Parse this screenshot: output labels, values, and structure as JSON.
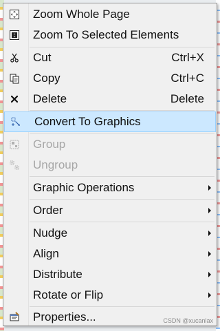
{
  "context_menu": {
    "items": [
      {
        "label": "Zoom Whole Page",
        "icon": "zoom-whole-page-icon"
      },
      {
        "label": "Zoom To Selected Elements",
        "icon": "zoom-selected-icon"
      },
      {
        "label": "Cut",
        "shortcut": "Ctrl+X",
        "icon": "scissors-icon"
      },
      {
        "label": "Copy",
        "shortcut": "Ctrl+C",
        "icon": "copy-icon"
      },
      {
        "label": "Delete",
        "shortcut": "Delete",
        "icon": "delete-icon"
      },
      {
        "label": "Convert To Graphics",
        "icon": "convert-to-graphics-icon",
        "state": "selected"
      },
      {
        "label": "Group",
        "icon": "group-icon",
        "state": "disabled"
      },
      {
        "label": "Ungroup",
        "icon": "ungroup-icon",
        "state": "disabled"
      },
      {
        "label": "Graphic Operations",
        "submenu": true
      },
      {
        "label": "Order",
        "submenu": true
      },
      {
        "label": "Nudge",
        "submenu": true
      },
      {
        "label": "Align",
        "submenu": true
      },
      {
        "label": "Distribute",
        "submenu": true
      },
      {
        "label": "Rotate or Flip",
        "submenu": true
      },
      {
        "label": "Properties...",
        "icon": "properties-icon"
      }
    ]
  },
  "watermark": "CSDN @xucanlax",
  "colors": {
    "menu_bg": "#f0f0f0",
    "selected_bg": "#cce8ff",
    "selected_border": "#99d1ff",
    "disabled_text": "#a7a7a7"
  }
}
